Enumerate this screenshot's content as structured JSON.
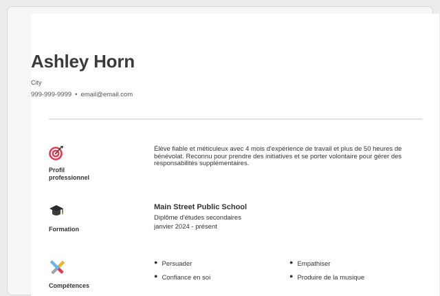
{
  "header": {
    "name": "Ashley Horn",
    "city": "City",
    "phone": "999-999-9999",
    "separator": "•",
    "email": "email@email.com"
  },
  "sections": {
    "summary": {
      "label": "Profil professionnel",
      "icon": "target-icon",
      "text": "Élève fiable et méticuleux avec 4 mois d'expérience de travail et plus de 50 heures de bénévolat. Reconnu pour prendre des initiatives et se porter volontaire pour gérer des responsabilités supplémentaires."
    },
    "education": {
      "label": "Formation",
      "icon": "graduation-cap-icon",
      "school": "Main Street Public School",
      "degree": "Diplôme d'études secondaires",
      "dates": "janvier 2024 - présent"
    },
    "skills": {
      "label": "Compétences",
      "icon": "tools-icon",
      "items": [
        "Persuader",
        "Empathiser",
        "Confiance en soi",
        "Produire de la musique"
      ]
    }
  },
  "colors": {
    "accent": "#e8384f",
    "text": "#333333",
    "rule": "#e4e4e4"
  }
}
